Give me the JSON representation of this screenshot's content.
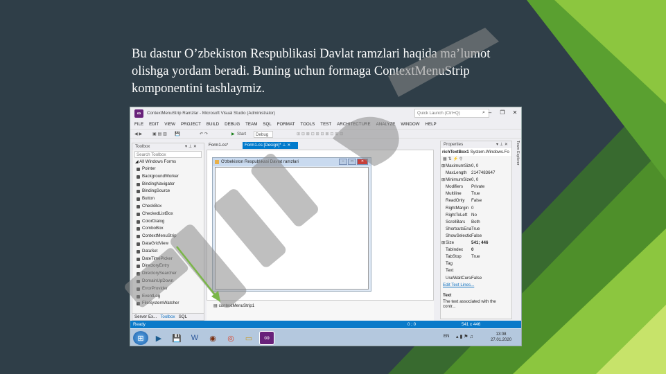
{
  "slide": {
    "caption": "Bu dastur O’zbekiston Respublikasi Davlat ramzlari haqida ma’lumot olishga yordam beradi. Buning uchun formaga ContextMenuStrip komponentini tashlaymiz."
  },
  "vs": {
    "title": "ContextMenuStrip Ramzlar - Microsoft Visual Studio (Administrator)",
    "quick_launch": "Quick Launch (Ctrl+Q)",
    "menu": [
      "FILE",
      "EDIT",
      "VIEW",
      "PROJECT",
      "BUILD",
      "DEBUG",
      "TEAM",
      "SQL",
      "FORMAT",
      "TOOLS",
      "TEST",
      "ARCHITECTURE",
      "ANALYZE",
      "WINDOW",
      "HELP"
    ],
    "toolbar": {
      "start": "Start",
      "config": "Debug"
    },
    "toolbox": {
      "header": "Toolbox",
      "search": "Search Toolbox",
      "category": "All Windows Forms",
      "items": [
        "Pointer",
        "BackgroundWorker",
        "BindingNavigator",
        "BindingSource",
        "Button",
        "CheckBox",
        "CheckedListBox",
        "ColorDialog",
        "ComboBox",
        "ContextMenuStrip",
        "DataGridView",
        "DataSet",
        "DateTimePicker",
        "DirectoryEntry",
        "DirectorySearcher",
        "DomainUpDown",
        "ErrorProvider",
        "EventLog",
        "FileSystemWatcher"
      ],
      "tabs": [
        "Server Ex...",
        "Toolbox",
        "SQL Serve..."
      ]
    },
    "doc_tabs": [
      "Form1.cs*",
      "Form1.cs [Design]*"
    ],
    "form": {
      "title": "O'zbekiston Respublikasi Davlat ramzlari"
    },
    "tray_item": "contextMenuStrip1",
    "side_tab": "Team Explorer",
    "properties": {
      "header": "Properties",
      "object": "richTextBox1",
      "object_type": "System.Windows.Fo",
      "rows": [
        {
          "name": "MaximumSize",
          "value": "0, 0",
          "expand": "⊞"
        },
        {
          "name": "MaxLength",
          "value": "2147483647",
          "expand": ""
        },
        {
          "name": "MinimumSize",
          "value": "0, 0",
          "expand": "⊞"
        },
        {
          "name": "Modifiers",
          "value": "Private",
          "expand": ""
        },
        {
          "name": "Multiline",
          "value": "True",
          "expand": ""
        },
        {
          "name": "ReadOnly",
          "value": "False",
          "expand": ""
        },
        {
          "name": "RightMargin",
          "value": "0",
          "expand": ""
        },
        {
          "name": "RightToLeft",
          "value": "No",
          "expand": ""
        },
        {
          "name": "ScrollBars",
          "value": "Both",
          "expand": ""
        },
        {
          "name": "ShortcutsEnabl",
          "value": "True",
          "expand": ""
        },
        {
          "name": "ShowSelection",
          "value": "False",
          "expand": ""
        },
        {
          "name": "Size",
          "value": "541; 446",
          "expand": "⊞"
        },
        {
          "name": "TabIndex",
          "value": "0",
          "expand": ""
        },
        {
          "name": "TabStop",
          "value": "True",
          "expand": ""
        },
        {
          "name": "Tag",
          "value": "",
          "expand": ""
        },
        {
          "name": "Text",
          "value": "",
          "expand": ""
        },
        {
          "name": "UseWaitCursor",
          "value": "False",
          "expand": ""
        }
      ],
      "link": "Edit Text Lines...",
      "desc_title": "Text",
      "desc": "The text associated with the contr..."
    },
    "status": {
      "left": "Ready",
      "pos": "0 ; 0",
      "size": "541 x 446"
    },
    "clock": {
      "time": "13:08",
      "date": "27.01.2020"
    },
    "tray_lang": "EN"
  }
}
